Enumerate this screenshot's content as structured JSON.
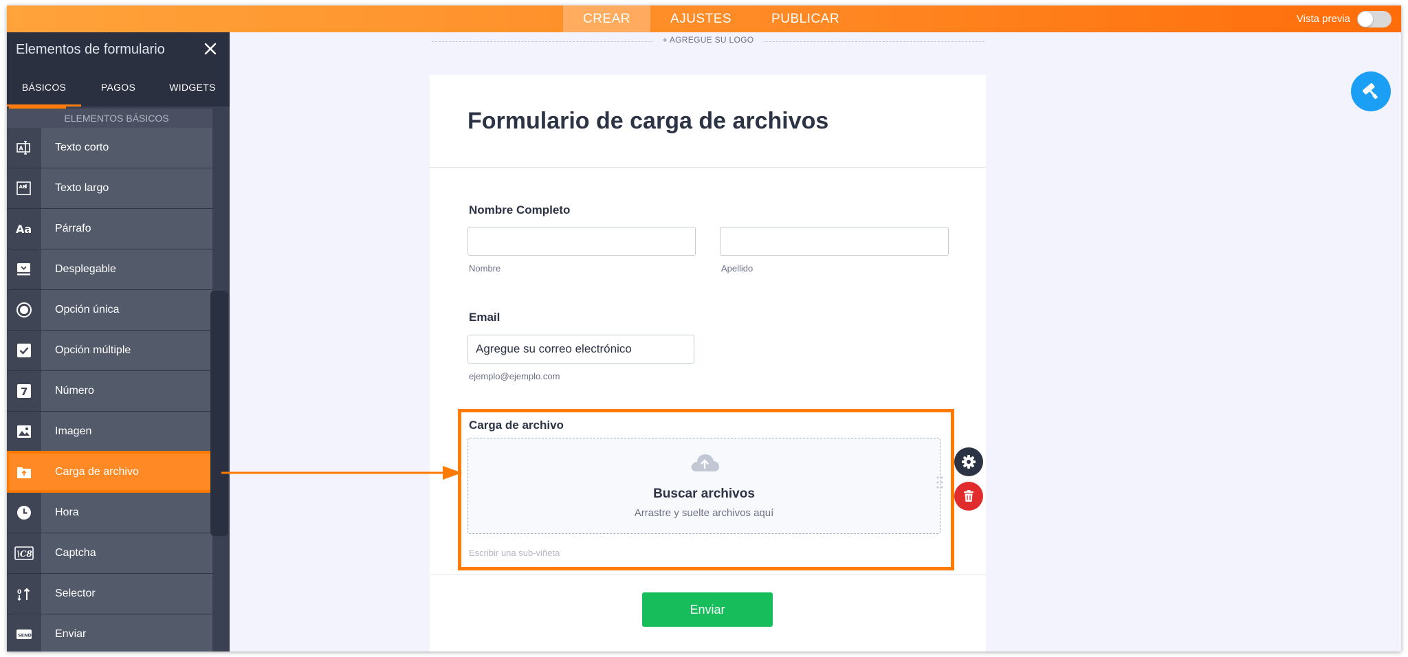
{
  "topbar": {
    "tabs": [
      {
        "label": "CREAR",
        "active": true
      },
      {
        "label": "AJUSTES",
        "active": false
      },
      {
        "label": "PUBLICAR",
        "active": false
      }
    ],
    "preview_label": "Vista previa",
    "gradient_colors": [
      "#ffa33a",
      "#ff6d0a"
    ]
  },
  "sidebar": {
    "title": "Elementos de formulario",
    "tabs": [
      {
        "label": "BÁSICOS",
        "active": true
      },
      {
        "label": "PAGOS",
        "active": false
      },
      {
        "label": "WIDGETS",
        "active": false
      }
    ],
    "section_label": "ELEMENTOS BÁSICOS",
    "items": [
      {
        "label": "Texto corto",
        "icon": "short-text-icon"
      },
      {
        "label": "Texto largo",
        "icon": "long-text-icon"
      },
      {
        "label": "Párrafo",
        "icon": "paragraph-icon"
      },
      {
        "label": "Desplegable",
        "icon": "dropdown-icon"
      },
      {
        "label": "Opción única",
        "icon": "radio-icon"
      },
      {
        "label": "Opción múltiple",
        "icon": "checkbox-icon"
      },
      {
        "label": "Número",
        "icon": "number-icon"
      },
      {
        "label": "Imagen",
        "icon": "image-icon"
      },
      {
        "label": "Carga de archivo",
        "icon": "file-upload-icon",
        "active": true
      },
      {
        "label": "Hora",
        "icon": "clock-icon"
      },
      {
        "label": "Captcha",
        "icon": "captcha-icon"
      },
      {
        "label": "Selector",
        "icon": "spinner-icon"
      },
      {
        "label": "Enviar",
        "icon": "send-icon"
      }
    ],
    "highlight_color": "#ff7a00"
  },
  "canvas": {
    "logo_placeholder": "+ AGREGUE SU LOGO",
    "form_title": "Formulario de carga de archivos",
    "fields": {
      "full_name": {
        "label": "Nombre Completo",
        "first_sub": "Nombre",
        "last_sub": "Apellido"
      },
      "email": {
        "label": "Email",
        "placeholder": "Agregue su correo electrónico",
        "sub": "ejemplo@ejemplo.com"
      },
      "upload": {
        "label": "Carga de archivo",
        "browse": "Buscar archivos",
        "hint": "Arrastre y suelte archivos aquí",
        "subvineta": "Escribir una sub-viñeta"
      }
    },
    "submit_label": "Enviar",
    "submit_color": "#18bd5b"
  }
}
